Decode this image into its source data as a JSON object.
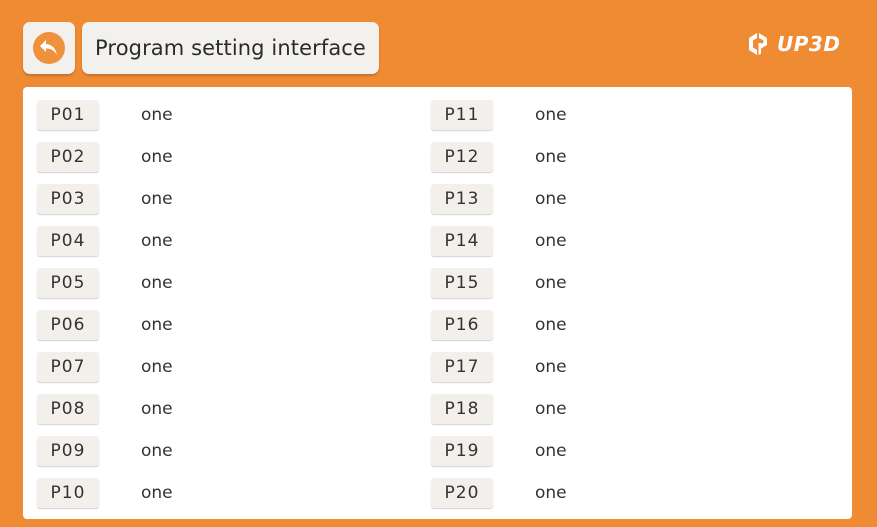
{
  "header": {
    "title": "Program setting interface",
    "logo_text": "UP3D",
    "back_icon": "back-arrow-icon",
    "logo_icon": "up3d-logo-icon"
  },
  "programs": {
    "p01": {
      "label": "P01",
      "name": "one"
    },
    "p02": {
      "label": "P02",
      "name": "one"
    },
    "p03": {
      "label": "P03",
      "name": "one"
    },
    "p04": {
      "label": "P04",
      "name": "one"
    },
    "p05": {
      "label": "P05",
      "name": "one"
    },
    "p06": {
      "label": "P06",
      "name": "one"
    },
    "p07": {
      "label": "P07",
      "name": "one"
    },
    "p08": {
      "label": "P08",
      "name": "one"
    },
    "p09": {
      "label": "P09",
      "name": "one"
    },
    "p10": {
      "label": "P10",
      "name": "one"
    },
    "p11": {
      "label": "P11",
      "name": "one"
    },
    "p12": {
      "label": "P12",
      "name": "one"
    },
    "p13": {
      "label": "P13",
      "name": "one"
    },
    "p14": {
      "label": "P14",
      "name": "one"
    },
    "p15": {
      "label": "P15",
      "name": "one"
    },
    "p16": {
      "label": "P16",
      "name": "one"
    },
    "p17": {
      "label": "P17",
      "name": "one"
    },
    "p18": {
      "label": "P18",
      "name": "one"
    },
    "p19": {
      "label": "P19",
      "name": "one"
    },
    "p20": {
      "label": "P20",
      "name": "one"
    }
  },
  "colors": {
    "accent": "#ef8b33",
    "button_bg": "#f3efea",
    "panel_bg": "#ffffff",
    "text": "#333333"
  }
}
